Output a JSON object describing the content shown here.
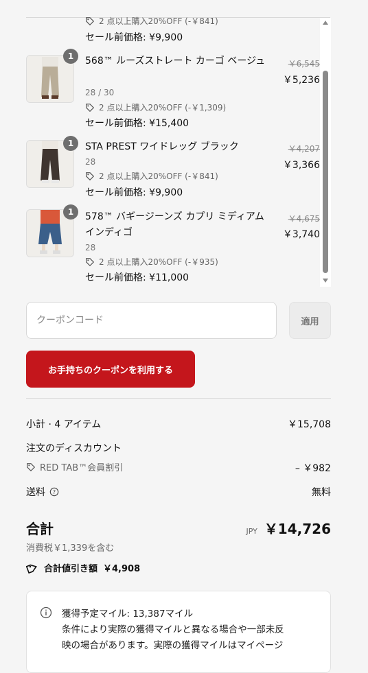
{
  "cart": {
    "items": [
      {
        "qty": "",
        "name": "",
        "variant": "",
        "promo": "2 点以上購入20%OFF (-￥841)",
        "presale": "セール前価格: ¥9,900",
        "orig": "",
        "price": ""
      },
      {
        "qty": "1",
        "name": "568™ ルーズストレート カーゴ ベージュ",
        "variant": "28 / 30",
        "promo": "2 点以上購入20%OFF (-￥1,309)",
        "presale": "セール前価格: ¥15,400",
        "orig": "￥6,545",
        "price": "￥5,236"
      },
      {
        "qty": "1",
        "name": "STA PREST ワイドレッグ ブラック",
        "variant": "28",
        "promo": "2 点以上購入20%OFF (-￥841)",
        "presale": "セール前価格: ¥9,900",
        "orig": "￥4,207",
        "price": "￥3,366"
      },
      {
        "qty": "1",
        "name": "578™ バギージーンズ カプリ ミディアムインディゴ",
        "variant": "28",
        "promo": "2 点以上購入20%OFF (-￥935)",
        "presale": "セール前価格: ¥11,000",
        "orig": "￥4,675",
        "price": "￥3,740"
      }
    ]
  },
  "coupon": {
    "placeholder": "クーポンコード",
    "apply_label": "適用",
    "use_label": "お手持ちのクーポンを利用する"
  },
  "summary": {
    "subtotal_label": "小計 · 4 アイテム",
    "subtotal_value": "￥15,708",
    "order_discount_label": "注文のディスカウント",
    "discount_name": "RED TAB™会員割引",
    "discount_value": "– ￥982",
    "shipping_label": "送料",
    "shipping_value": "無料",
    "total_label": "合計",
    "currency": "JPY",
    "total_value": "￥14,726",
    "tax_note": "消費税￥1,339を含む",
    "total_saving_label": "合計値引き額",
    "total_saving_value": "￥4,908"
  },
  "miles": {
    "line1": "獲得予定マイル: 13,387マイル",
    "line2": "条件により実際の獲得マイルと異なる場合や一部未反",
    "line3": "映の場合があります。実際の獲得マイルはマイページ"
  },
  "colors": {
    "accent": "#c4161c",
    "badge": "#6e6e6e"
  },
  "icons": [
    "tag-icon",
    "help-circle-icon",
    "info-icon",
    "scroll-arrow-up-icon",
    "scroll-arrow-down-icon"
  ]
}
